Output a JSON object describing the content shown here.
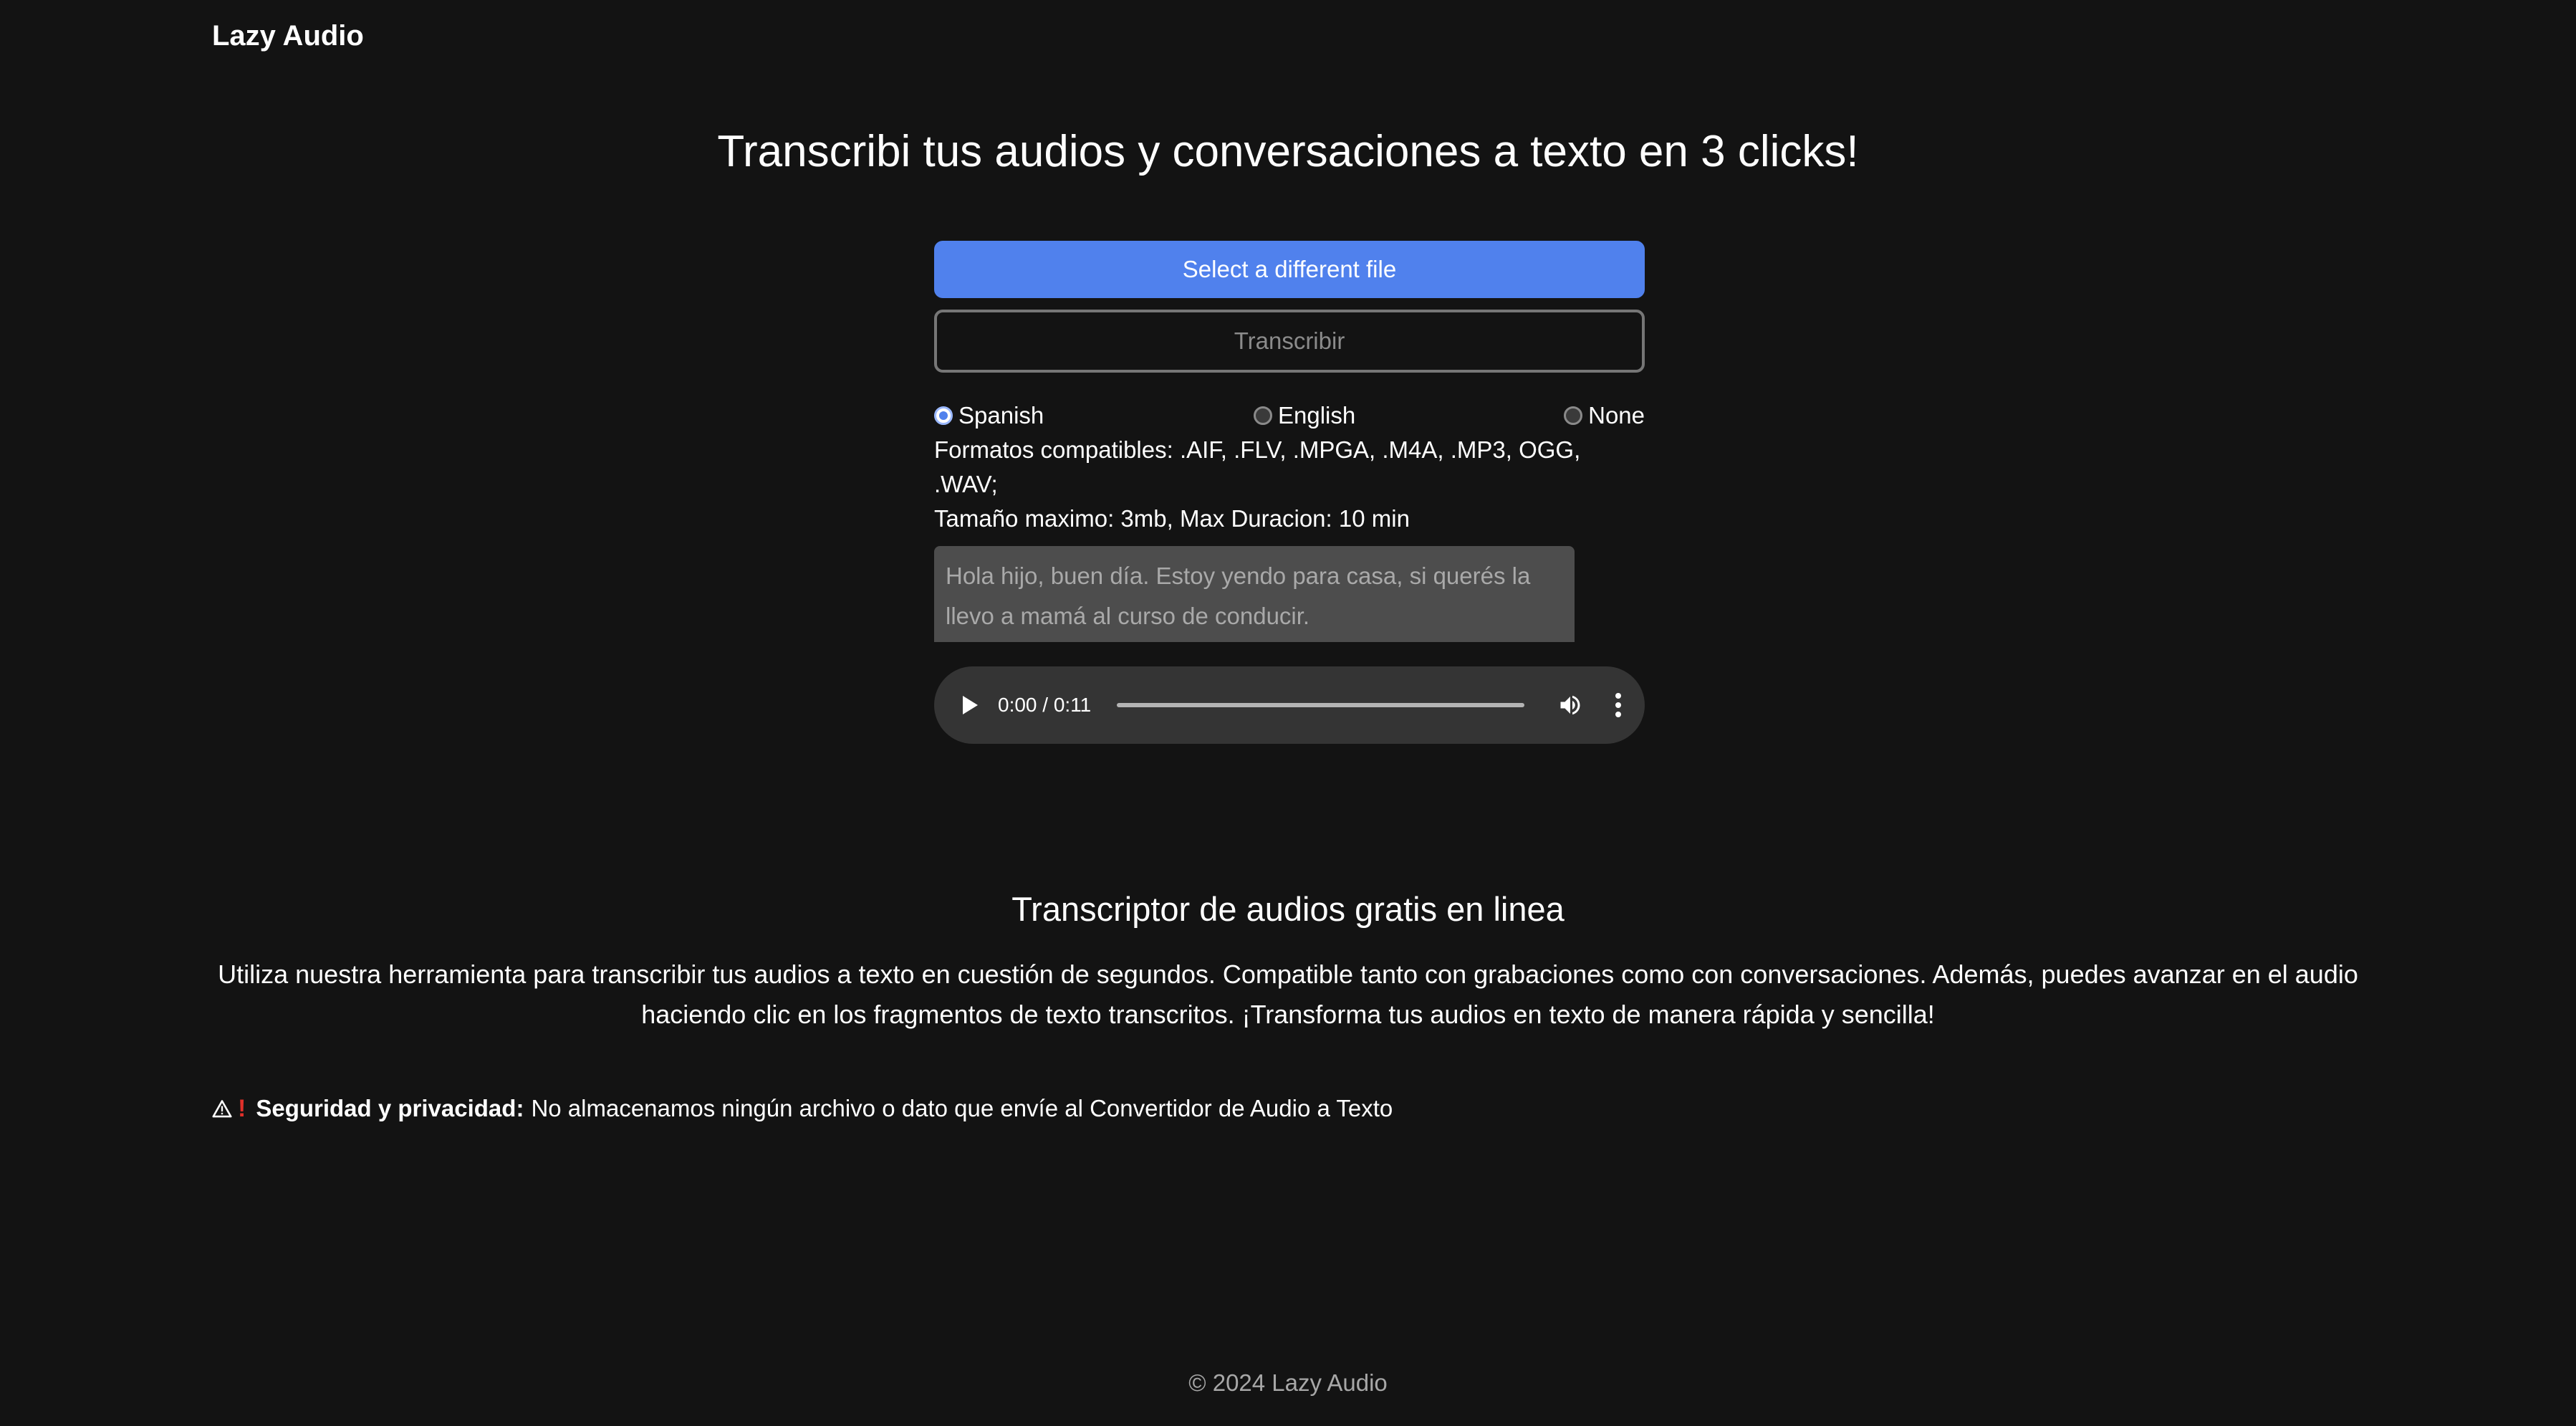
{
  "header": {
    "brand": "Lazy Audio"
  },
  "hero": {
    "title": "Transcribi tus audios y conversaciones a texto en 3 clicks!"
  },
  "uploader": {
    "select_button": "Select a different file",
    "transcribe_button": "Transcribir",
    "languages": [
      {
        "label": "Spanish",
        "checked": true
      },
      {
        "label": "English",
        "checked": false
      },
      {
        "label": "None",
        "checked": false
      }
    ],
    "formats_line": "Formatos compatibles: .AIF, .FLV, .MPGA, .M4A, .MP3, OGG, .WAV;",
    "limits_line": "Tamaño maximo: 3mb, Max Duracion: 10 min",
    "transcript_text": "Hola hijo, buen día. Estoy yendo para casa, si querés la llevo a mamá al curso de conducir."
  },
  "audio_player": {
    "time": "0:00 / 0:11",
    "progress": 0,
    "icons": [
      "play-icon",
      "volume-icon",
      "more-options-icon"
    ]
  },
  "info": {
    "title": "Transcriptor de audios gratis en linea",
    "description": "Utiliza nuestra herramienta para transcribir tus audios a texto en cuestión de segundos. Compatible tanto con grabaciones como con conversaciones. Además, puedes avanzar en el audio haciendo clic en los fragmentos de texto transcritos. ¡Transforma tus audios en texto de manera rápida y sencilla!"
  },
  "security": {
    "icons": [
      "warning-icon",
      "exclamation-icon"
    ],
    "label": "Seguridad y privacidad:",
    "text": "No almacenamos ningún archivo o dato que envíe al Convertidor de Audio a Texto"
  },
  "footer": {
    "copyright": "© 2024 Lazy Audio"
  },
  "colors": {
    "background": "#131313",
    "primary": "#5081ed",
    "transcript_bg": "#4d4d4d",
    "player_bg": "#343434",
    "accent_red": "#e0302a"
  }
}
